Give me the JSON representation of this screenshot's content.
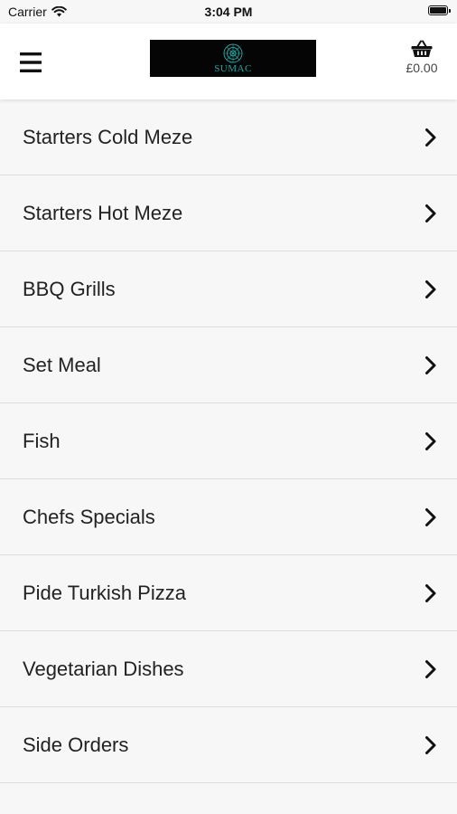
{
  "status_bar": {
    "carrier": "Carrier",
    "time": "3:04 PM"
  },
  "header": {
    "logo_text": "SUMAC",
    "cart_total": "£0.00",
    "logo_accent": "#1fa7a1"
  },
  "categories": [
    {
      "label": "Starters Cold Meze"
    },
    {
      "label": "Starters Hot Meze"
    },
    {
      "label": "BBQ Grills"
    },
    {
      "label": "Set Meal"
    },
    {
      "label": "Fish"
    },
    {
      "label": "Chefs Specials"
    },
    {
      "label": "Pide Turkish Pizza"
    },
    {
      "label": "Vegetarian Dishes"
    },
    {
      "label": "Side Orders"
    }
  ]
}
